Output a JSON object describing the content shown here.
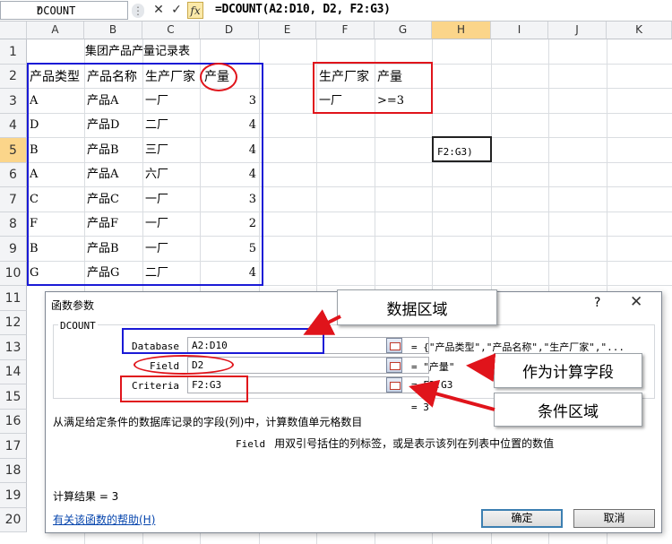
{
  "formula_bar": {
    "name_box": "DCOUNT",
    "cancel_glyph": "✕",
    "enter_glyph": "✓",
    "fx_glyph": "fx",
    "formula": "=DCOUNT(A2:D10, D2, F2:G3)"
  },
  "columns": [
    "A",
    "B",
    "C",
    "D",
    "E",
    "F",
    "G",
    "H",
    "I",
    "J",
    "K"
  ],
  "rows": [
    "1",
    "2",
    "3",
    "4",
    "5",
    "6",
    "7",
    "8",
    "9",
    "10",
    "11",
    "12",
    "13",
    "14",
    "15",
    "16",
    "17",
    "18",
    "19",
    "20"
  ],
  "sheet": {
    "title": "集团产品产量记录表",
    "headers": [
      "产品类型",
      "产品名称",
      "生产厂家",
      "产量"
    ],
    "records": [
      [
        "A",
        "产品A",
        "一厂",
        "3"
      ],
      [
        "D",
        "产品D",
        "二厂",
        "4"
      ],
      [
        "B",
        "产品B",
        "三厂",
        "4"
      ],
      [
        "A",
        "产品A",
        "六厂",
        "4"
      ],
      [
        "C",
        "产品C",
        "一厂",
        "3"
      ],
      [
        "F",
        "产品F",
        "一厂",
        "2"
      ],
      [
        "B",
        "产品B",
        "一厂",
        "5"
      ],
      [
        "G",
        "产品G",
        "二厂",
        "4"
      ]
    ],
    "criteria": {
      "headers": [
        "生产厂家",
        "产量"
      ],
      "values": [
        "一厂",
        ">=3"
      ]
    },
    "active_cell_text": "F2:G3)"
  },
  "dialog": {
    "title": "函数参数",
    "help_glyph": "?",
    "close_glyph": "✕",
    "function_name": "DCOUNT",
    "args": [
      {
        "label": "Database",
        "value": "A2:D10",
        "result": "= {\"产品类型\",\"产品名称\",\"生产厂家\",\"..."
      },
      {
        "label": "Field",
        "value": "D2",
        "result": "= \"产量\""
      },
      {
        "label": "Criteria",
        "value": "F2:G3",
        "result": "= F2:G3"
      }
    ],
    "function_result": "= 3",
    "description": "从满足给定条件的数据库记录的字段(列)中，计算数值单元格数目",
    "arg_name": "Field",
    "arg_description": "用双引号括住的列标签，或是表示该列在列表中位置的数值",
    "calc_result": "计算结果 =   3",
    "help_link": "有关该函数的帮助(H)",
    "ok": "确定",
    "cancel": "取消"
  },
  "callouts": {
    "database": "数据区域",
    "field": "作为计算字段",
    "criteria": "条件区域"
  },
  "colors": {
    "annotation_red": "#e0141b",
    "annotation_blue": "#1a1ad6",
    "selected_header": "#fbd58a"
  }
}
